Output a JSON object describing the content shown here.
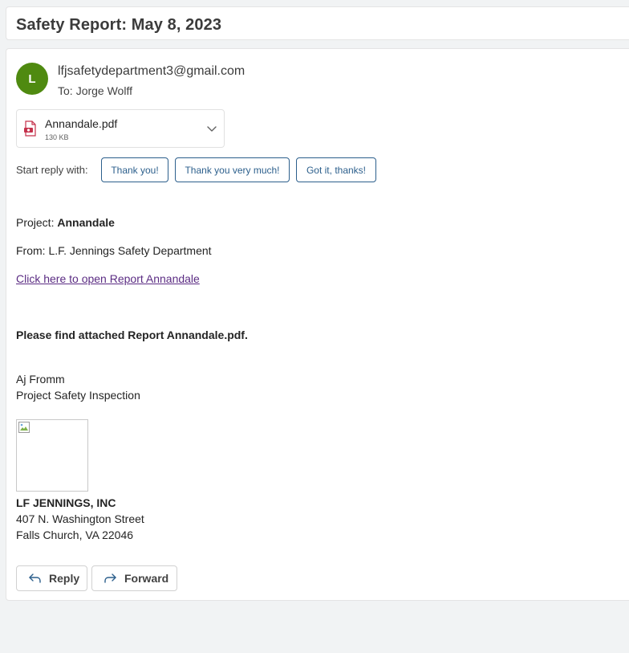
{
  "subject": "Safety Report: May 8, 2023",
  "sender": {
    "initial": "L",
    "email": "lfjsafetydepartment3@gmail.com",
    "to_prefix": "To:",
    "to_name": "Jorge Wolff",
    "avatar_color": "#4f8a10"
  },
  "attachment": {
    "name": "Annandale.pdf",
    "size": "130 KB",
    "icon": "pdf-file-icon"
  },
  "quick_reply": {
    "prompt": "Start reply with:",
    "options": [
      "Thank you!",
      "Thank you very much!",
      "Got it, thanks!"
    ]
  },
  "body": {
    "project_label": "Project: ",
    "project_name": "Annandale",
    "from_line": "From: L.F. Jennings Safety Department",
    "link_text": "Click here to open Report Annandale",
    "attached_note": "Please find attached Report Annandale.pdf.",
    "signature_name": "Aj Fromm",
    "signature_title": "Project Safety Inspection",
    "company": "LF JENNINGS, INC",
    "address_line1": "407 N. Washington Street",
    "address_line2": "Falls Church, VA 22046"
  },
  "actions": {
    "reply": "Reply",
    "forward": "Forward"
  },
  "colors": {
    "accent": "#2c5f8c",
    "link_visited": "#5b2c83",
    "pdf_red": "#c4314b"
  }
}
